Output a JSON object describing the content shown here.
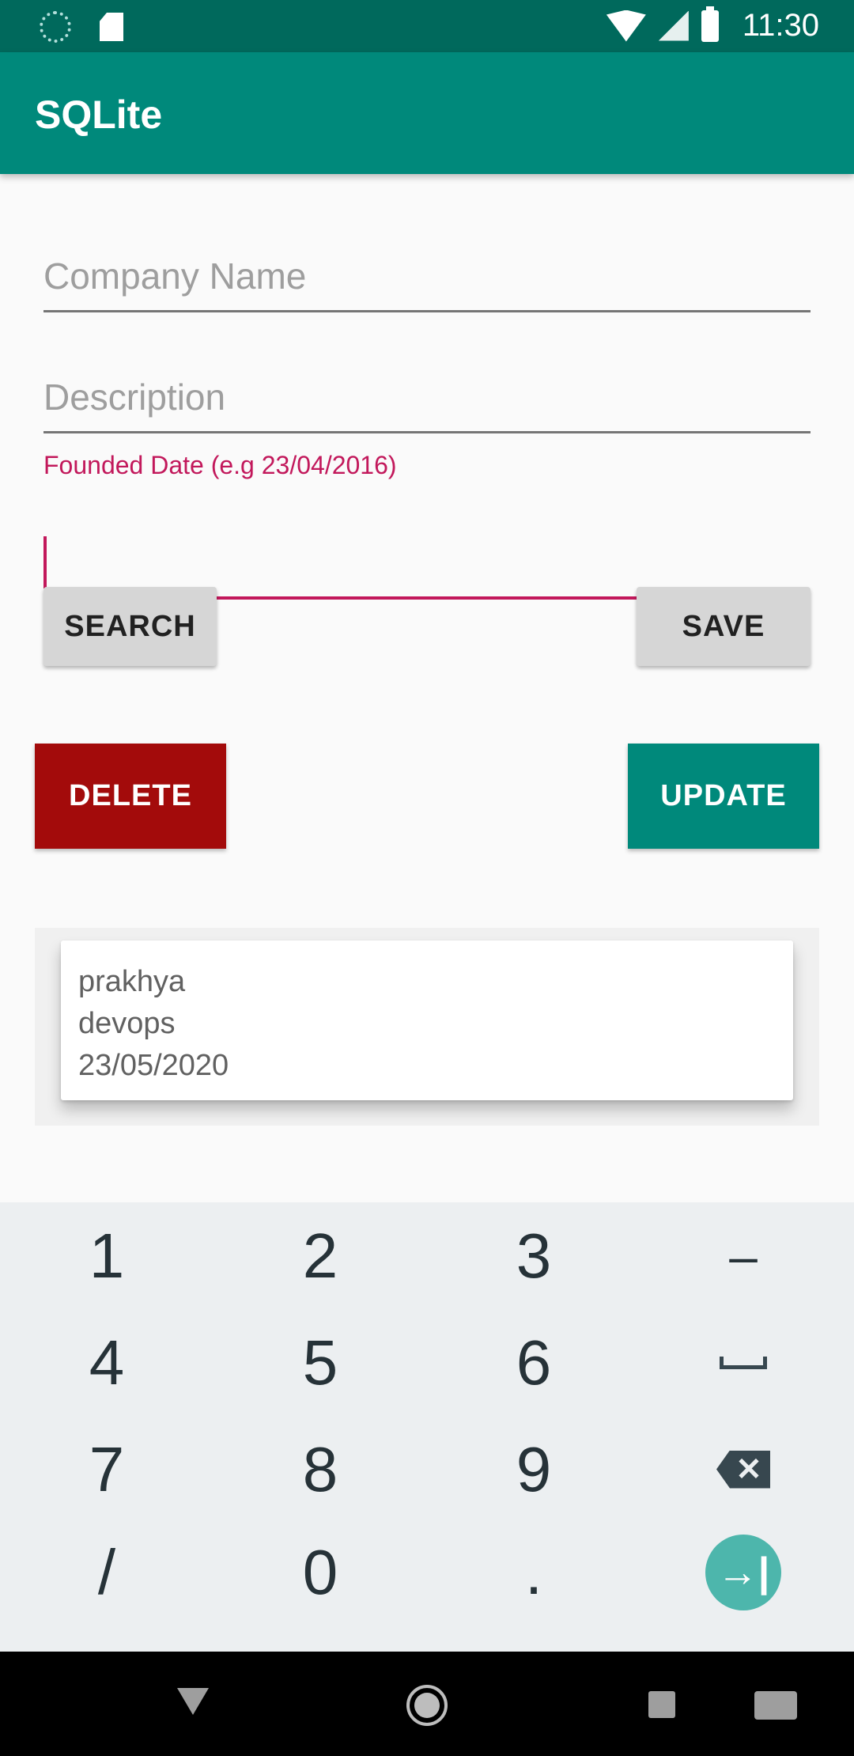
{
  "status_bar": {
    "time": "11:30",
    "icons": [
      "sync-icon",
      "sd-card-icon",
      "wifi-icon",
      "signal-icon",
      "battery-icon"
    ]
  },
  "app_bar": {
    "title": "SQLite",
    "color": "#00897b"
  },
  "form": {
    "company_name_placeholder": "Company Name",
    "description_placeholder": "Description",
    "founded_date_label": "Founded Date (e.g 23/04/2016)",
    "founded_date_value": ""
  },
  "buttons": {
    "search": "SEARCH",
    "save": "SAVE",
    "delete": "DELETE",
    "update": "UPDATE"
  },
  "records": [
    {
      "name": "prakhya",
      "description": "devops",
      "date": "23/05/2020"
    }
  ],
  "keyboard": {
    "row1": [
      "1",
      "2",
      "3",
      "–"
    ],
    "row2": [
      "4",
      "5",
      "6"
    ],
    "row3": [
      "7",
      "8",
      "9"
    ],
    "row4": [
      "/",
      "0",
      "."
    ],
    "backspace_glyph": "✕",
    "go_glyph": "→|"
  },
  "colors": {
    "accent": "#c2185b",
    "delete": "#a30b0b",
    "primary_dark": "#00695c"
  }
}
